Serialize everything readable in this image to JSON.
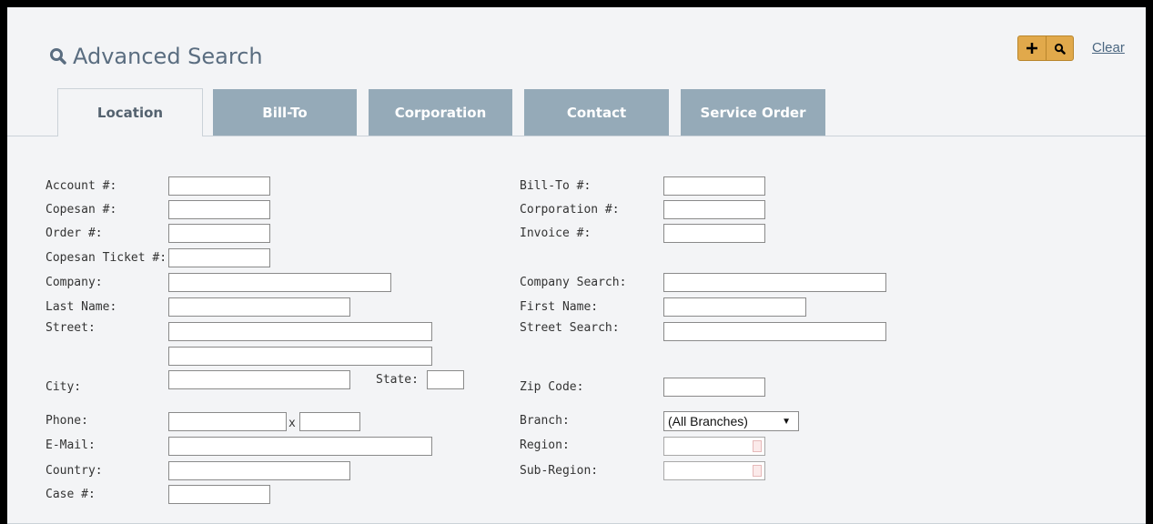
{
  "header": {
    "title": "Advanced Search",
    "add_button_icon": "plus-icon",
    "search_button_icon": "search-icon",
    "clear_label": "Clear"
  },
  "tabs": [
    {
      "label": "Location",
      "active": true
    },
    {
      "label": "Bill-To",
      "active": false
    },
    {
      "label": "Corporation",
      "active": false
    },
    {
      "label": "Contact",
      "active": false
    },
    {
      "label": "Service Order",
      "active": false
    }
  ],
  "form": {
    "account": "Account #:",
    "copesan": "Copesan #:",
    "order": "Order #:",
    "copesan_ticket": "Copesan Ticket #:",
    "company": "Company:",
    "last_name": "Last Name:",
    "street": "Street:",
    "city": "City:",
    "state": "State:",
    "phone": "Phone:",
    "phone_ext_sep": "x",
    "email": "E-Mail:",
    "country": "Country:",
    "case": "Case #:",
    "bill_to": "Bill-To #:",
    "corporation": "Corporation #:",
    "invoice": "Invoice #:",
    "company_search": "Company Search:",
    "first_name": "First Name:",
    "street_search": "Street Search:",
    "zip_code": "Zip Code:",
    "branch": "Branch:",
    "branch_selected": "(All Branches)",
    "region": "Region:",
    "sub_region": "Sub-Region:"
  },
  "colors": {
    "tab_inactive": "#95aab8",
    "button_accent": "#e1a94b",
    "title": "#5a6d80"
  }
}
